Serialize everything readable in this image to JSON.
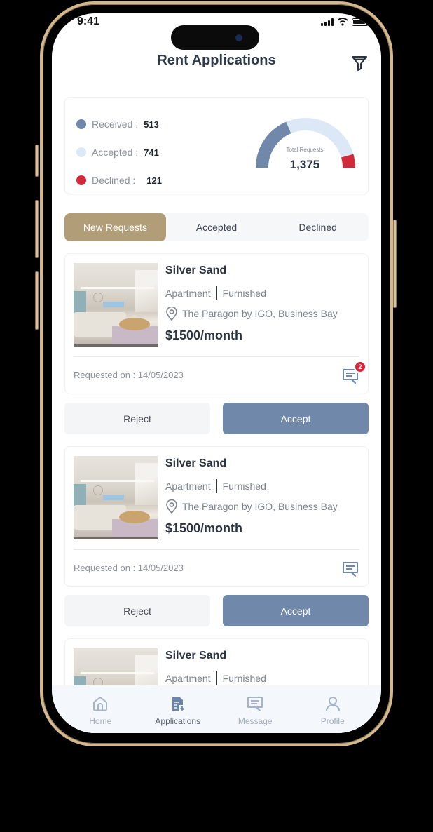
{
  "status_bar": {
    "time": "9:41"
  },
  "header": {
    "title": "Rent Applications",
    "filter_icon": "filter-icon"
  },
  "summary": {
    "legend": [
      {
        "label": "Received :",
        "value": "513",
        "color": "#7088a9"
      },
      {
        "label": "Accepted :",
        "value": "741",
        "color": "#dde8f6"
      },
      {
        "label": "Declined :",
        "value": "121",
        "color": "#d22a3b"
      }
    ],
    "gauge": {
      "caption": "Total Requests",
      "total": "1,375",
      "segments": [
        {
          "name": "Received",
          "value": 513,
          "color": "#7088a9"
        },
        {
          "name": "Accepted",
          "value": 741,
          "color": "#dde8f6"
        },
        {
          "name": "Declined",
          "value": 121,
          "color": "#d22a3b"
        }
      ]
    }
  },
  "tabs": [
    {
      "label": "New Requests",
      "active": true
    },
    {
      "label": "Accepted",
      "active": false
    },
    {
      "label": "Declined",
      "active": false
    }
  ],
  "applications": [
    {
      "name": "Silver Sand",
      "type": "Apartment",
      "furnishing": "Furnished",
      "location": "The Paragon by IGO, Business Bay",
      "price": "$1500/month",
      "requested_on": "Requested on : 14/05/2023",
      "unread_messages": "2"
    },
    {
      "name": "Silver Sand",
      "type": "Apartment",
      "furnishing": "Furnished",
      "location": "The Paragon by IGO, Business Bay",
      "price": "$1500/month",
      "requested_on": "Requested on : 14/05/2023"
    },
    {
      "name": "Silver Sand",
      "type": "Apartment",
      "furnishing": "Furnished"
    }
  ],
  "actions": {
    "reject_label": "Reject",
    "accept_label": "Accept"
  },
  "bottom_nav": [
    {
      "label": "Home",
      "icon": "home-icon",
      "active": false
    },
    {
      "label": "Applications",
      "icon": "applications-icon",
      "active": true
    },
    {
      "label": "Message",
      "icon": "message-icon",
      "active": false
    },
    {
      "label": "Profile",
      "icon": "profile-icon",
      "active": false
    }
  ]
}
